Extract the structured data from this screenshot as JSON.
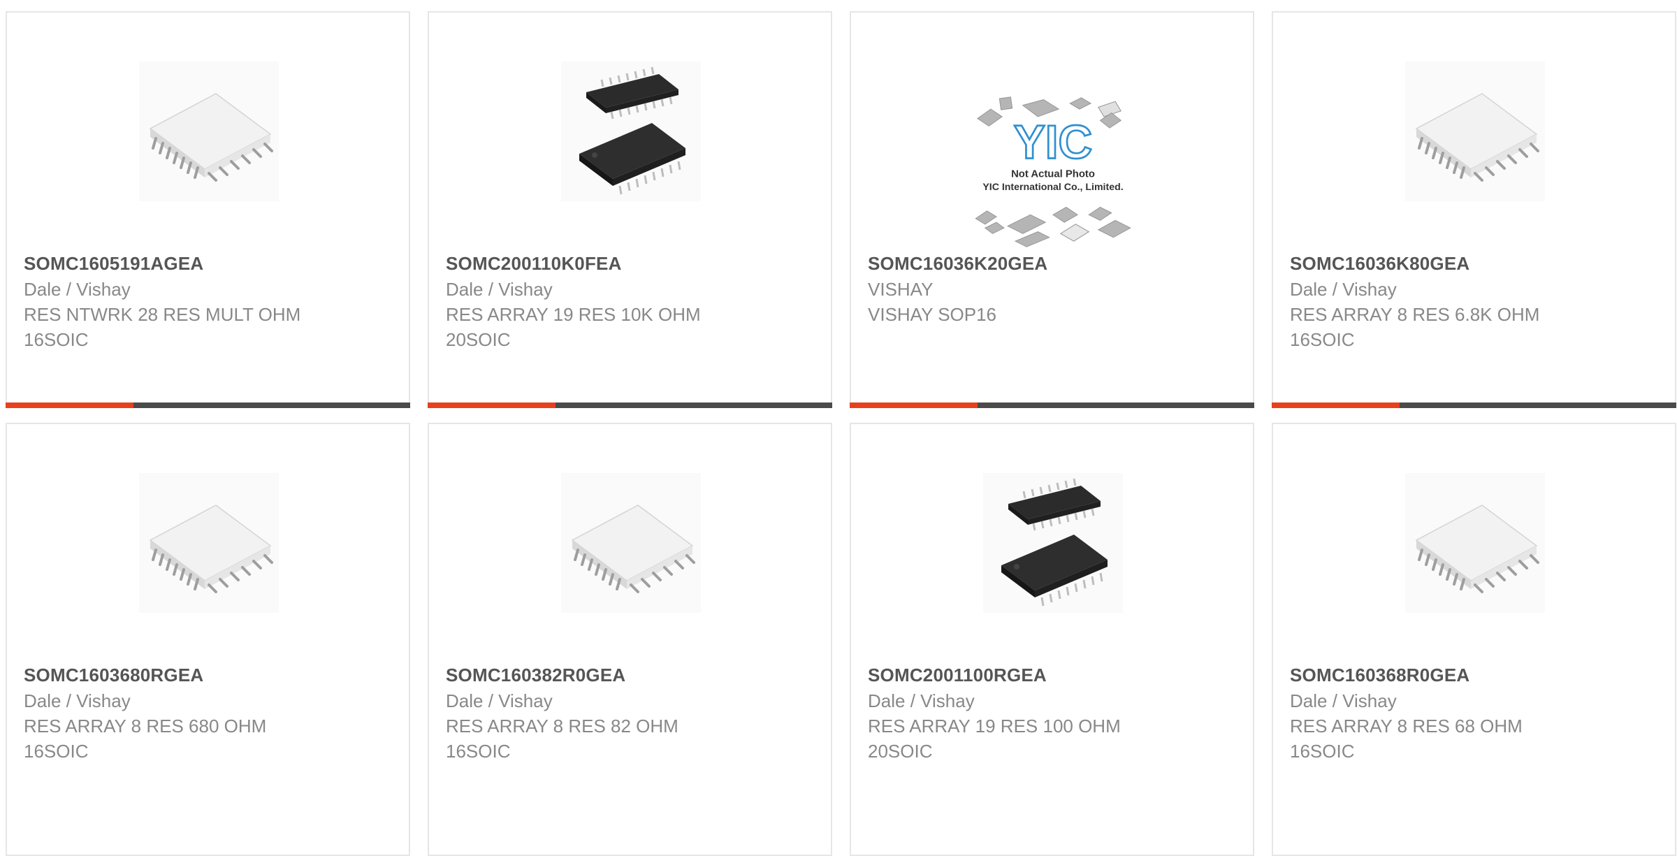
{
  "products": [
    {
      "part": "SOMC1605191AGEA",
      "manufacturer": "Dale / Vishay",
      "description": "RES NTWRK 28 RES MULT OHM 16SOIC",
      "image": "white-soic-chip-icon"
    },
    {
      "part": "SOMC200110K0FEA",
      "manufacturer": "Dale / Vishay",
      "description": "RES ARRAY 19 RES 10K OHM 20SOIC",
      "image": "black-soic-chip-pair-icon"
    },
    {
      "part": "SOMC16036K20GEA",
      "manufacturer": "VISHAY",
      "description": "VISHAY SOP16",
      "image": "yic-placeholder-icon",
      "placeholder_logo": "YIC",
      "placeholder_line1": "Not Actual Photo",
      "placeholder_line2": "YIC International Co., Limited."
    },
    {
      "part": "SOMC16036K80GEA",
      "manufacturer": "Dale / Vishay",
      "description": "RES ARRAY 8 RES 6.8K OHM 16SOIC",
      "image": "white-soic-chip-icon"
    },
    {
      "part": "SOMC1603680RGEA",
      "manufacturer": "Dale / Vishay",
      "description": "RES ARRAY 8 RES 680 OHM 16SOIC",
      "image": "white-soic-chip-icon"
    },
    {
      "part": "SOMC160382R0GEA",
      "manufacturer": "Dale / Vishay",
      "description": "RES ARRAY 8 RES 82 OHM 16SOIC",
      "image": "white-soic-chip-icon"
    },
    {
      "part": "SOMC2001100RGEA",
      "manufacturer": "Dale / Vishay",
      "description": "RES ARRAY 19 RES 100 OHM 20SOIC",
      "image": "black-soic-chip-pair-icon"
    },
    {
      "part": "SOMC160368R0GEA",
      "manufacturer": "Dale / Vishay",
      "description": "RES ARRAY 8 RES 68 OHM 16SOIC",
      "image": "white-soic-chip-icon"
    }
  ],
  "colors": {
    "accent": "#e8401c",
    "bar": "#4a4a4a",
    "part_text": "#555555",
    "secondary_text": "#888888",
    "border": "#e6e6e6"
  }
}
